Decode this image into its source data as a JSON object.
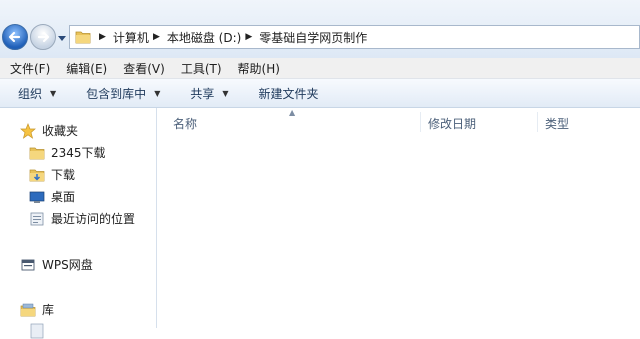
{
  "address": {
    "crumbs": [
      "计算机",
      "本地磁盘 (D:)",
      "零基础自学网页制作"
    ]
  },
  "menu": [
    "文件(F)",
    "编辑(E)",
    "查看(V)",
    "工具(T)",
    "帮助(H)"
  ],
  "toolbar": {
    "organize": "组织",
    "include_in_library": "包含到库中",
    "share": "共享",
    "new_folder": "新建文件夹"
  },
  "nav": {
    "favorites": "收藏夹",
    "fav_items": [
      "2345下载",
      "下载",
      "桌面",
      "最近访问的位置"
    ],
    "wps": "WPS网盘",
    "libraries": "库"
  },
  "columns": {
    "name": "名称",
    "date_modified": "修改日期",
    "type": "类型"
  },
  "colors": {
    "toolbar_text": "#1e395b",
    "column_header_text": "#4c607a",
    "accent_blue": "#1f5fb8"
  }
}
